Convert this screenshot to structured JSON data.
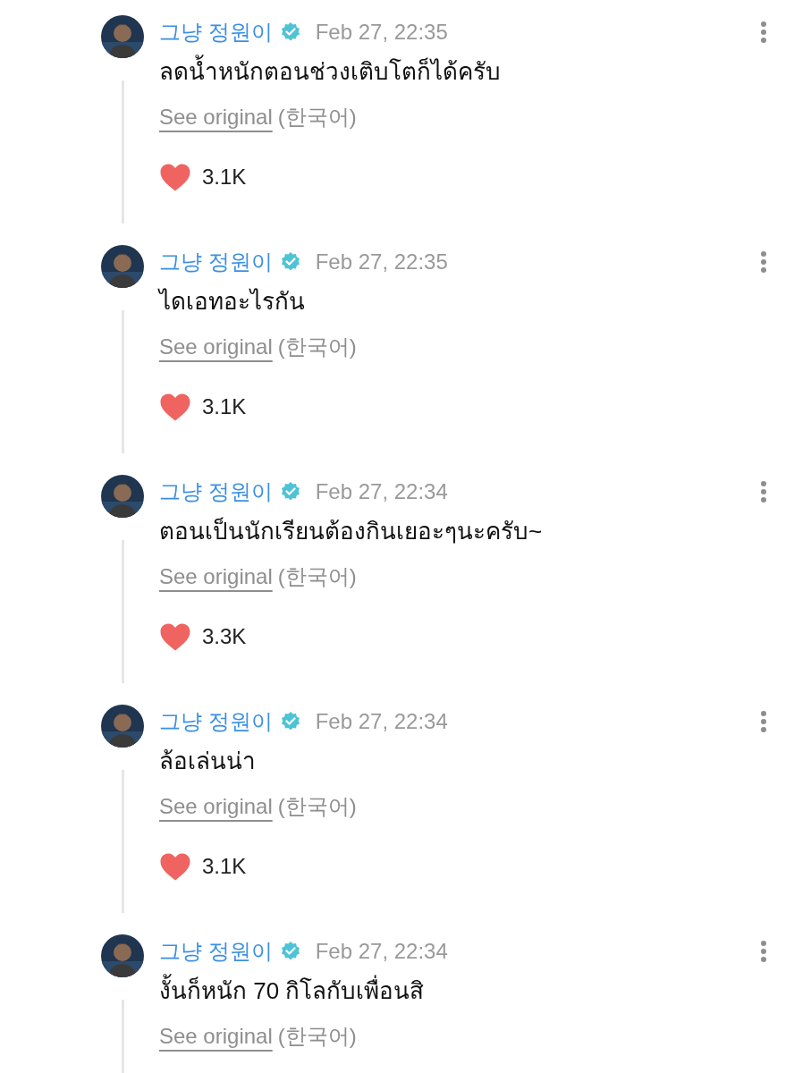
{
  "posts": [
    {
      "author": "그냥 정원이",
      "verified": true,
      "time": "Feb 27, 22:35",
      "text": "ลดน้ำหนักตอนช่วงเติบโตก็ได้ครับ",
      "see_original": "See original",
      "language": "(한국어)",
      "likes": "3.1K"
    },
    {
      "author": "그냥 정원이",
      "verified": true,
      "time": "Feb 27, 22:35",
      "text": "ไดเอทอะไรกัน",
      "see_original": "See original",
      "language": "(한국어)",
      "likes": "3.1K"
    },
    {
      "author": "그냥 정원이",
      "verified": true,
      "time": "Feb 27, 22:34",
      "text": "ตอนเป็นนักเรียนต้องกินเยอะๆนะครับ~",
      "see_original": "See original",
      "language": "(한국어)",
      "likes": "3.3K"
    },
    {
      "author": "그냥 정원이",
      "verified": true,
      "time": "Feb 27, 22:34",
      "text": "ล้อเล่นน่า",
      "see_original": "See original",
      "language": "(한국어)",
      "likes": "3.1K"
    },
    {
      "author": "그냥 정원이",
      "verified": true,
      "time": "Feb 27, 22:34",
      "text": "งั้นก็หนัก 70 กิโลกับเพื่อนสิ",
      "see_original": "See original",
      "language": "(한국어)"
    }
  ]
}
